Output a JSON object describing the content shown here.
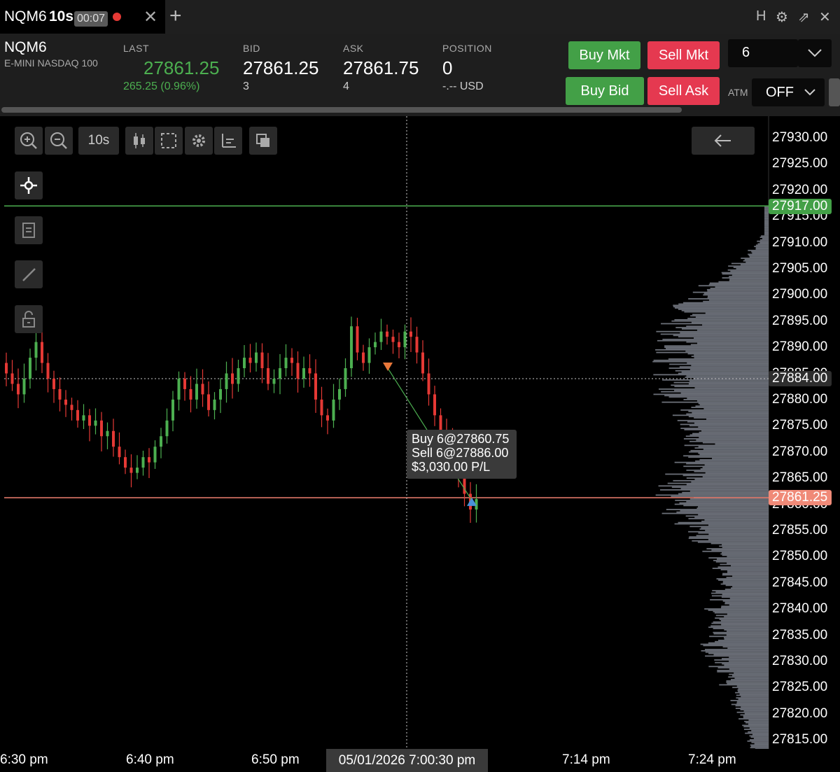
{
  "tab": {
    "symbol": "NQM6",
    "interval": "10s",
    "timer": "00:07",
    "close_glyph": "✕",
    "add_glyph": "+"
  },
  "window_controls": {
    "h_label": "H",
    "settings_glyph": "⚙",
    "popout_glyph": "⇗",
    "close_glyph": "✕"
  },
  "quote": {
    "symbol": "NQM6",
    "description": "E-MINI NASDAQ 100",
    "last_label": "LAST",
    "last": "27861.25",
    "change": "265.25 (0.96%)",
    "bid_label": "BID",
    "bid": "27861.25",
    "bid_size": "3",
    "ask_label": "ASK",
    "ask": "27861.75",
    "ask_size": "4",
    "position_label": "POSITION",
    "position": "0",
    "position_pl": "-.-- USD"
  },
  "order": {
    "buy_mkt": "Buy Mkt",
    "sell_mkt": "Sell Mkt",
    "buy_bid": "Buy Bid",
    "sell_ask": "Sell Ask",
    "quantity": "6",
    "atm_label": "ATM",
    "atm_value": "OFF"
  },
  "toolbar": {
    "interval_label": "10s"
  },
  "price_axis": [
    "27930.00",
    "27925.00",
    "27920.00",
    "27915.00",
    "27910.00",
    "27905.00",
    "27900.00",
    "27895.00",
    "27890.00",
    "27885.00",
    "27880.00",
    "27875.00",
    "27870.00",
    "27865.00",
    "27860.00",
    "27855.00",
    "27850.00",
    "27845.00",
    "27840.00",
    "27835.00",
    "27830.00",
    "27825.00",
    "27820.00",
    "27815.00"
  ],
  "price_tags": {
    "high_line": "27917.00",
    "crosshair": "27884.00",
    "last": "27861.25"
  },
  "time_axis": [
    "6:30 pm",
    "6:40 pm",
    "6:50 pm",
    "7:14 pm",
    "7:24 pm"
  ],
  "crosshair_time": "05/01/2026 7:00:30 pm",
  "trade_tooltip": {
    "buy": "Buy 6@27860.75",
    "sell": "Sell 6@27886.00",
    "pl": "$3,030.00 P/L"
  },
  "colors": {
    "up": "#4caf50",
    "down": "#e53935",
    "last_line": "#f08070",
    "high_line": "#4caf50",
    "profile": "#6b6f78",
    "button_green": "#43a047",
    "button_red": "#e53950"
  },
  "chart_data": {
    "type": "candlestick",
    "interval": "10s",
    "closes": [
      27885,
      27883,
      27881,
      27884,
      27888,
      27891,
      27887,
      27884,
      27882,
      27880,
      27879,
      27878,
      27876,
      27877,
      27875,
      27876,
      27873,
      27874,
      27871,
      27869,
      27867,
      27866,
      27867,
      27869,
      27868,
      27871,
      27873,
      27876,
      27880,
      27884,
      27882,
      27880,
      27883,
      27881,
      27878,
      27880,
      27882,
      27885,
      27883,
      27886,
      27888,
      27887,
      27889,
      27886,
      27883,
      27884,
      27886,
      27888,
      27887,
      27884,
      27886,
      27885,
      27880,
      27877,
      27876,
      27880,
      27882,
      27886,
      27894,
      27889,
      27887,
      27890,
      27891,
      27893,
      27892,
      27891,
      27890,
      27893,
      27892,
      27889,
      27885,
      27881,
      27877,
      27874,
      27873,
      27870,
      27866,
      27862,
      27859,
      27861
    ],
    "price_range": [
      27813,
      27934
    ],
    "high_line": 27917.0,
    "crosshair_price": 27884.0,
    "last_price": 27861.25,
    "entry": {
      "side": "Sell",
      "qty": 6,
      "price": 27886.0
    },
    "exit": {
      "side": "Buy",
      "qty": 6,
      "price": 27860.75
    },
    "volume_profile": "horizontal histogram on right side, widest near 27862 and 27884"
  }
}
